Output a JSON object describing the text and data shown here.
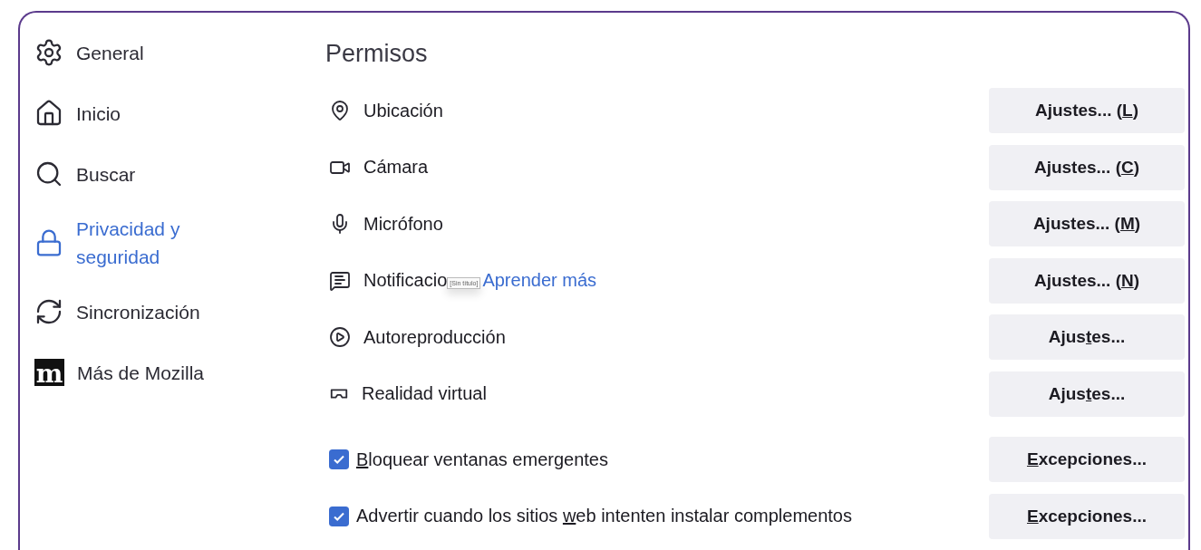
{
  "sidebar": {
    "items": [
      {
        "label": "General",
        "selected": false
      },
      {
        "label": "Inicio",
        "selected": false
      },
      {
        "label": "Buscar",
        "selected": false
      },
      {
        "label": "Privacidad y seguridad",
        "selected": true
      },
      {
        "label": "Sincronización",
        "selected": false
      },
      {
        "label": "Más de Mozilla",
        "selected": false,
        "logo_text": "m"
      }
    ]
  },
  "permissions": {
    "title": "Permisos",
    "rows": [
      {
        "label": "Ubicación",
        "button": {
          "pre": "Ajustes... (",
          "key": "L",
          "post": ")"
        }
      },
      {
        "label": "Cámara",
        "button": {
          "pre": "Ajustes... (",
          "key": "C",
          "post": ")"
        }
      },
      {
        "label": "Micrófono",
        "button": {
          "pre": "Ajustes... (",
          "key": "M",
          "post": ")"
        }
      },
      {
        "label": "Notificacio",
        "tooltip": "[Sin título]",
        "link": "Aprender más",
        "button": {
          "pre": "Ajustes... (",
          "key": "N",
          "post": ")"
        }
      },
      {
        "label": "Autoreproducción",
        "button": {
          "pre": "Ajus",
          "key": "t",
          "post": "es..."
        }
      },
      {
        "label": "Realidad virtual",
        "button": {
          "pre": "Ajus",
          "key": "t",
          "post": "es..."
        }
      }
    ],
    "checks": [
      {
        "label": {
          "key": "B",
          "post": "loquear ventanas emergentes"
        },
        "checked": true,
        "button": {
          "key": "E",
          "post": "xcepciones..."
        }
      },
      {
        "label": {
          "pre": "Advertir cuando los sitios ",
          "key": "w",
          "post": "eb intenten instalar complementos"
        },
        "checked": true,
        "button": {
          "key": "E",
          "post": "xcepciones..."
        }
      }
    ]
  }
}
